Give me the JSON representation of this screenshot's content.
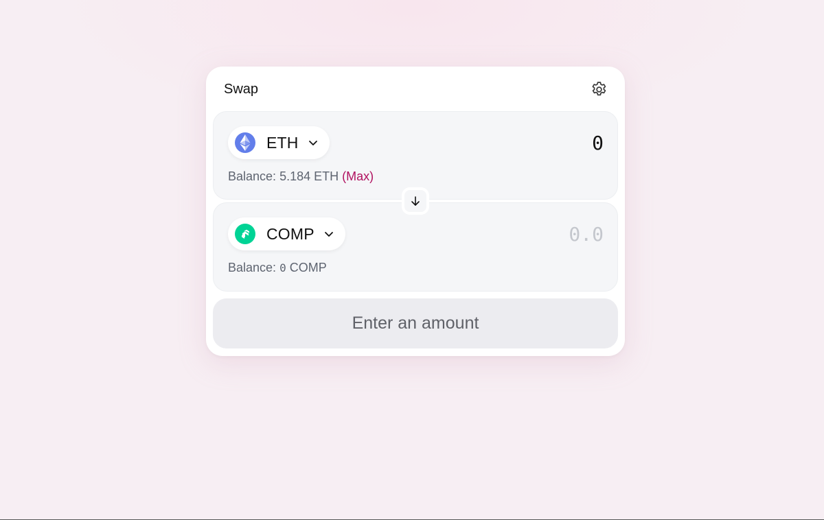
{
  "card": {
    "title": "Swap"
  },
  "icons": {
    "settings": "gear-icon",
    "swap_direction": "arrow-down-icon",
    "dropdown": "chevron-down-icon"
  },
  "from": {
    "token_symbol": "ETH",
    "token_icon": "ethereum-logo-icon",
    "amount": "0",
    "balance_label": "Balance: ",
    "balance_value": "5.184",
    "balance_unit": " ETH ",
    "max_label": "(Max)"
  },
  "to": {
    "token_symbol": "COMP",
    "token_icon": "compound-logo-icon",
    "amount_placeholder": "0.0",
    "balance_label": "Balance: ",
    "balance_value": "0",
    "balance_unit": " COMP"
  },
  "cta": {
    "label": "Enter an amount"
  },
  "colors": {
    "accent_max": "#b0115f",
    "eth_icon": "#627eea",
    "comp_icon": "#00d395",
    "panel_bg": "#f5f6f8",
    "button_bg": "#ececf0"
  }
}
